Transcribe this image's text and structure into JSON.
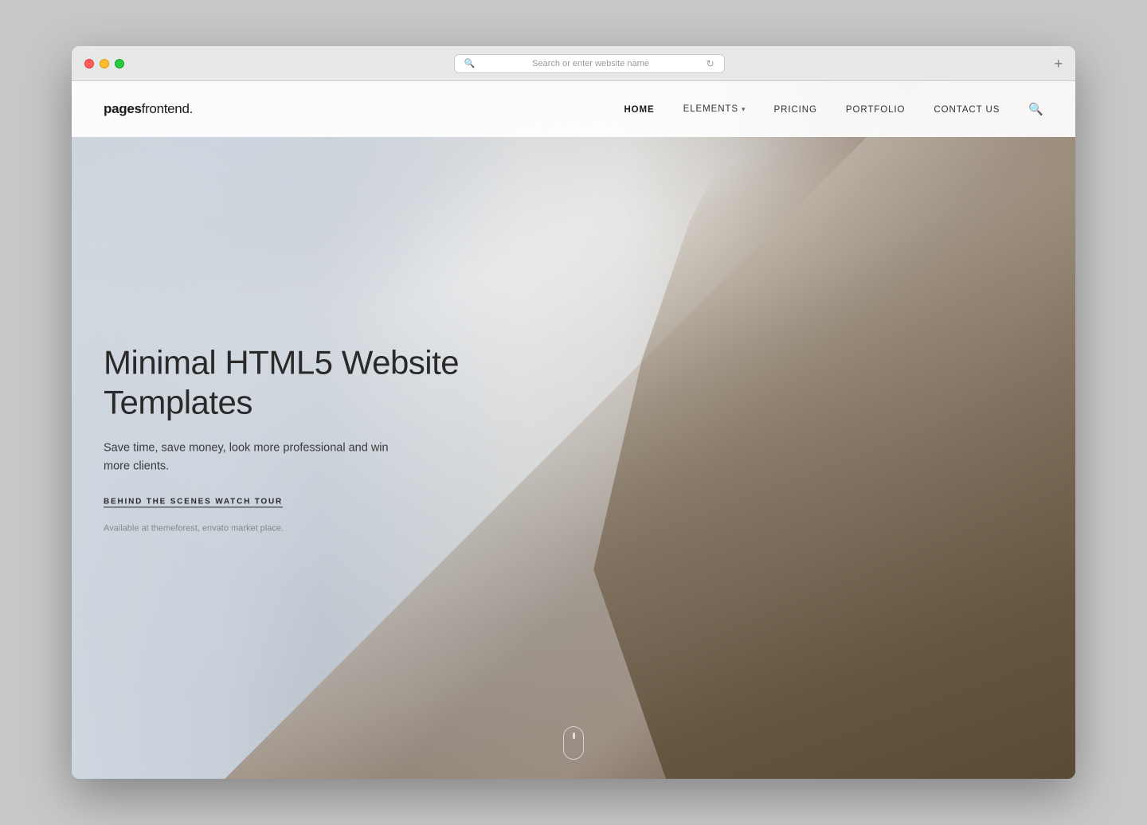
{
  "browser": {
    "address_placeholder": "Search or enter website name",
    "new_tab_icon": "+"
  },
  "nav": {
    "logo_bold": "pages",
    "logo_normal": "frontend",
    "logo_dot": ".",
    "links": [
      {
        "id": "home",
        "label": "HOME",
        "active": true
      },
      {
        "id": "elements",
        "label": "ELEMENTS",
        "has_dropdown": true
      },
      {
        "id": "pricing",
        "label": "PRICING",
        "active": false
      },
      {
        "id": "portfolio",
        "label": "PORTFOLIO",
        "active": false
      },
      {
        "id": "contact",
        "label": "CONTACT US",
        "active": false
      }
    ]
  },
  "hero": {
    "title": "Minimal HTML5 Website Templates",
    "subtitle": "Save time, save money, look more professional and win more clients.",
    "cta_label": "BEHIND THE SCENES WATCH TOUR",
    "market_text": "Available at themeforest, envato market place."
  }
}
